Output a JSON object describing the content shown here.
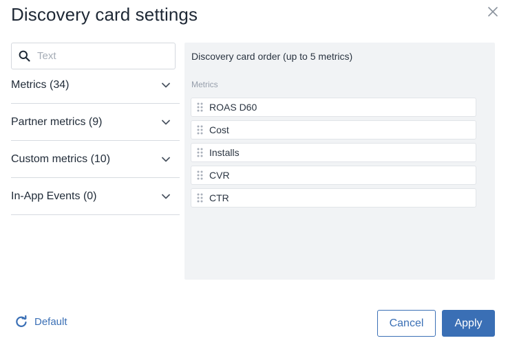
{
  "dialog": {
    "title": "Discovery card settings",
    "close_icon": "close-icon"
  },
  "search": {
    "placeholder": "Text",
    "value": "",
    "icon": "search-icon"
  },
  "accordion": [
    {
      "label": "Metrics (34)"
    },
    {
      "label": "Partner metrics (9)"
    },
    {
      "label": "Custom metrics (10)"
    },
    {
      "label": "In-App Events (0)"
    }
  ],
  "order_panel": {
    "title": "Discovery card order (up to 5 metrics)",
    "subtitle": "Metrics",
    "metrics": [
      {
        "label": "ROAS D60"
      },
      {
        "label": "Cost"
      },
      {
        "label": "Installs"
      },
      {
        "label": "CVR"
      },
      {
        "label": "CTR"
      }
    ]
  },
  "footer": {
    "default_label": "Default",
    "cancel_label": "Cancel",
    "apply_label": "Apply"
  },
  "colors": {
    "accent": "#3a6fb5",
    "panel_bg": "#f1f3f5",
    "border": "#d6dae0"
  }
}
